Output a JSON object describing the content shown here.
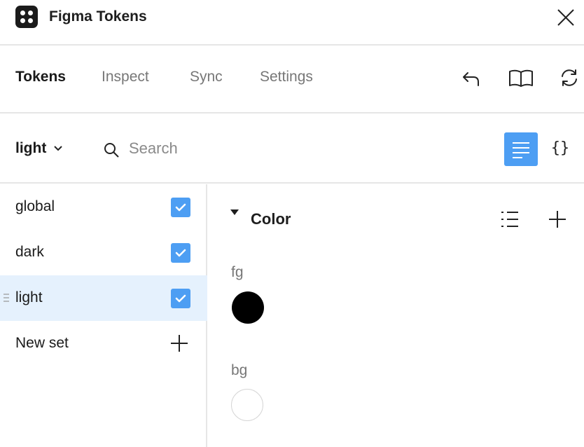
{
  "app": {
    "title": "Figma Tokens"
  },
  "tabs": [
    {
      "label": "Tokens",
      "active": true
    },
    {
      "label": "Inspect",
      "active": false
    },
    {
      "label": "Sync",
      "active": false
    },
    {
      "label": "Settings",
      "active": false
    }
  ],
  "toolbar": {
    "theme": "light",
    "search_placeholder": "Search",
    "json_view_glyph": "{}"
  },
  "sets": [
    {
      "label": "global",
      "checked": true,
      "active": false
    },
    {
      "label": "dark",
      "checked": true,
      "active": false
    },
    {
      "label": "light",
      "checked": true,
      "active": true
    }
  ],
  "new_set_label": "New set",
  "group": {
    "title": "Color",
    "tokens": [
      {
        "name": "fg",
        "color": "#000000"
      },
      {
        "name": "bg",
        "color": "#ffffff"
      }
    ]
  },
  "colors": {
    "accent": "#4d9ef3",
    "active_row": "#e5f1fd",
    "divider": "#e6e6e6"
  },
  "icons": [
    "app-logo",
    "close-icon",
    "undo-icon",
    "book-icon",
    "refresh-icon",
    "chevron-down-icon",
    "search-icon",
    "list-view-icon",
    "json-view-icon",
    "check-icon",
    "drag-handle-icon",
    "plus-icon",
    "triangle-down-icon",
    "list-icon"
  ]
}
